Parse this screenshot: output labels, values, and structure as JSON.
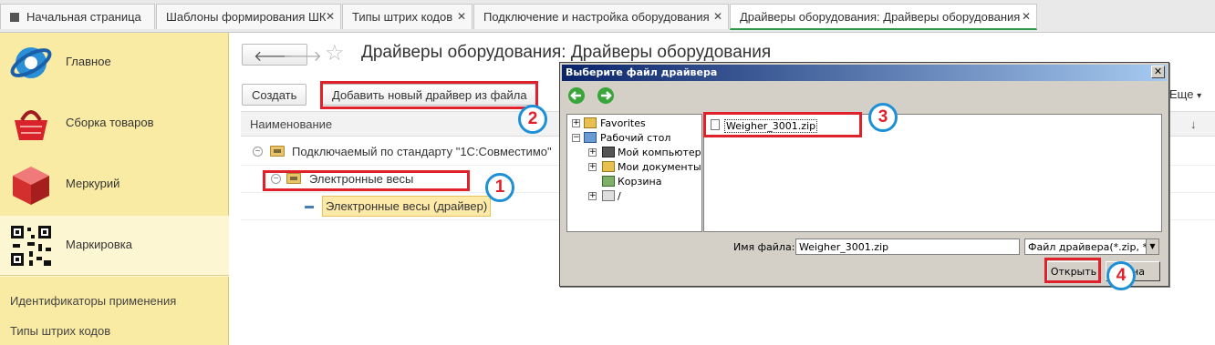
{
  "tabs": [
    {
      "label": "Начальная страница"
    },
    {
      "label": "Шаблоны формирования ШК"
    },
    {
      "label": "Типы штрих кодов"
    },
    {
      "label": "Подключение и настройка оборудования"
    },
    {
      "label": "Драйверы оборудования: Драйверы оборудования"
    }
  ],
  "sidebar": {
    "items": [
      {
        "label": "Главное",
        "icon": "main-globe-icon"
      },
      {
        "label": "Сборка товаров",
        "icon": "basket-icon"
      },
      {
        "label": "Меркурий",
        "icon": "cube-icon"
      },
      {
        "label": "Маркировка",
        "icon": "qr-code-icon"
      }
    ],
    "links": [
      "Идентификаторы применения",
      "Типы штрих кодов"
    ]
  },
  "page": {
    "title": "Драйверы оборудования: Драйверы оборудования",
    "create_label": "Создать",
    "add_driver_label": "Добавить новый драйвер из файла",
    "more_label": "Еще",
    "column_name": "Наименование",
    "sort_icon": "↓"
  },
  "tree": [
    {
      "label": "Подключаемый по стандарту \"1С:Совместимо\""
    },
    {
      "label": "Электронные весы"
    },
    {
      "label": "Электронные весы (драйвер)"
    }
  ],
  "dialog": {
    "title": "Выберите файл драйвера",
    "tree_nodes": [
      {
        "label": "Favorites"
      },
      {
        "label": "Рабочий стол"
      },
      {
        "label": "Мой компьютер"
      },
      {
        "label": "Мои документы"
      },
      {
        "label": "Корзина"
      },
      {
        "label": "/"
      }
    ],
    "file": "Weigher_3001.zip",
    "filename_label": "Имя файла:",
    "filename_value": "Weigher_3001.zip",
    "filetype_value": "Файл драйвера(*.zip, *.e",
    "open_label": "Открыть",
    "cancel_visible": "на"
  },
  "badges": [
    "1",
    "2",
    "3",
    "4"
  ],
  "colors": {
    "highlight": "#e0202a",
    "badge_ring": "#1e90d8",
    "sidebar": "#faeba4",
    "active_tab": "#2b9a45"
  }
}
